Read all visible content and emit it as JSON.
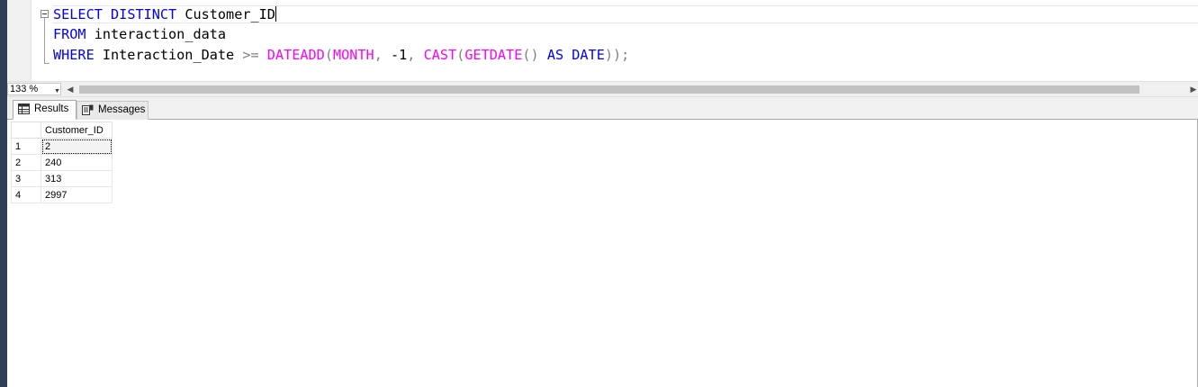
{
  "editor": {
    "line1": {
      "kw1": "SELECT",
      "kw2": "DISTINCT",
      "col": "Customer_ID"
    },
    "line2": {
      "kw": "FROM",
      "table": "interaction_data"
    },
    "line3": {
      "kw": "WHERE",
      "col": "Interaction_Date",
      "op": ">=",
      "fn1": "DATEADD",
      "paren1": "(",
      "fn2": "MONTH",
      "comma1": ",",
      "num": "-1",
      "comma2": ",",
      "fn3": "CAST",
      "paren2": "(",
      "fn4": "GETDATE",
      "parens": "()",
      "kw2": "AS",
      "kw3": "DATE",
      "close": "));"
    }
  },
  "statusbar": {
    "zoom": "133 %"
  },
  "tabs": {
    "results": "Results",
    "messages": "Messages"
  },
  "grid": {
    "header": "Customer_ID",
    "rows": [
      {
        "num": "1",
        "value": "2"
      },
      {
        "num": "2",
        "value": "240"
      },
      {
        "num": "3",
        "value": "313"
      },
      {
        "num": "4",
        "value": "2997"
      }
    ]
  },
  "colors": {
    "keyword": "#0000ff",
    "function": "#ff00ff",
    "operator": "#808080"
  }
}
